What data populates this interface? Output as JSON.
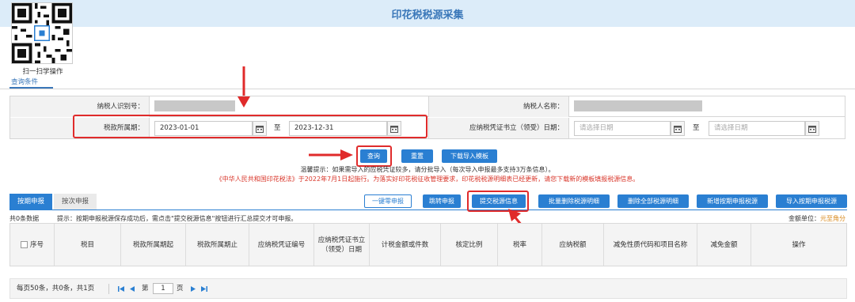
{
  "header": {
    "title": "印花税税源采集",
    "scan_label": "扫一扫学操作",
    "query_tab": "查询条件"
  },
  "form": {
    "taxpayer_id_label": "纳税人识别号：",
    "taxpayer_name_label": "纳税人名称：",
    "tax_period_label": "税款所属期：",
    "tax_period_start": "2023-01-01",
    "tax_period_to": "至",
    "tax_period_end": "2023-12-31",
    "voucher_date_label": "应纳税凭证书立（领受）日期：",
    "voucher_date_start_placeholder": "请选择日期",
    "voucher_date_to": "至",
    "voucher_date_end_placeholder": "请选择日期"
  },
  "actions": {
    "query": "查询",
    "reset": "重置",
    "download_template": "下载导入模板"
  },
  "hints": {
    "line1": "温馨提示：如果需导入的应税凭证较多，请分批导入（每次导入申报最多支持3万条信息）。",
    "line2": "《中华人民共和国印花税法》于2022年7月1日起施行。为落实好印花税征收管理要求，印花税税源明细表已经更新，请您下载新的模板填报税源信息。"
  },
  "tabs": [
    "按期申报",
    "按次申报"
  ],
  "toolbar": {
    "zero_declare": "一键零申报",
    "transfer": "跳转申报",
    "submit_source": "提交税源信息",
    "batch_delete": "批量删除税源明细",
    "delete_all": "删除全部税源明细",
    "add_period": "新增按期申报税源",
    "import_period": "导入按期申报税源"
  },
  "info": {
    "count": "共0条数据",
    "tip": "提示：按期申报税源保存成功后，需点击\"提交税源信息\"按钮进行汇总提交才可申报。",
    "amount_unit_label": "金额单位：",
    "amount_unit_value": "元至角分"
  },
  "table": {
    "columns": [
      "序号",
      "税目",
      "税款所属期起",
      "税款所属期止",
      "应纳税凭证编号",
      "应纳税凭证书立（领受）日期",
      "计税金额或件数",
      "核定比例",
      "税率",
      "应纳税额",
      "减免性质代码和项目名称",
      "减免金额",
      "操作"
    ]
  },
  "pager": {
    "summary": "每页50条，共0条，共1页",
    "page_prefix": "第",
    "page_value": "1",
    "page_suffix": "页"
  }
}
